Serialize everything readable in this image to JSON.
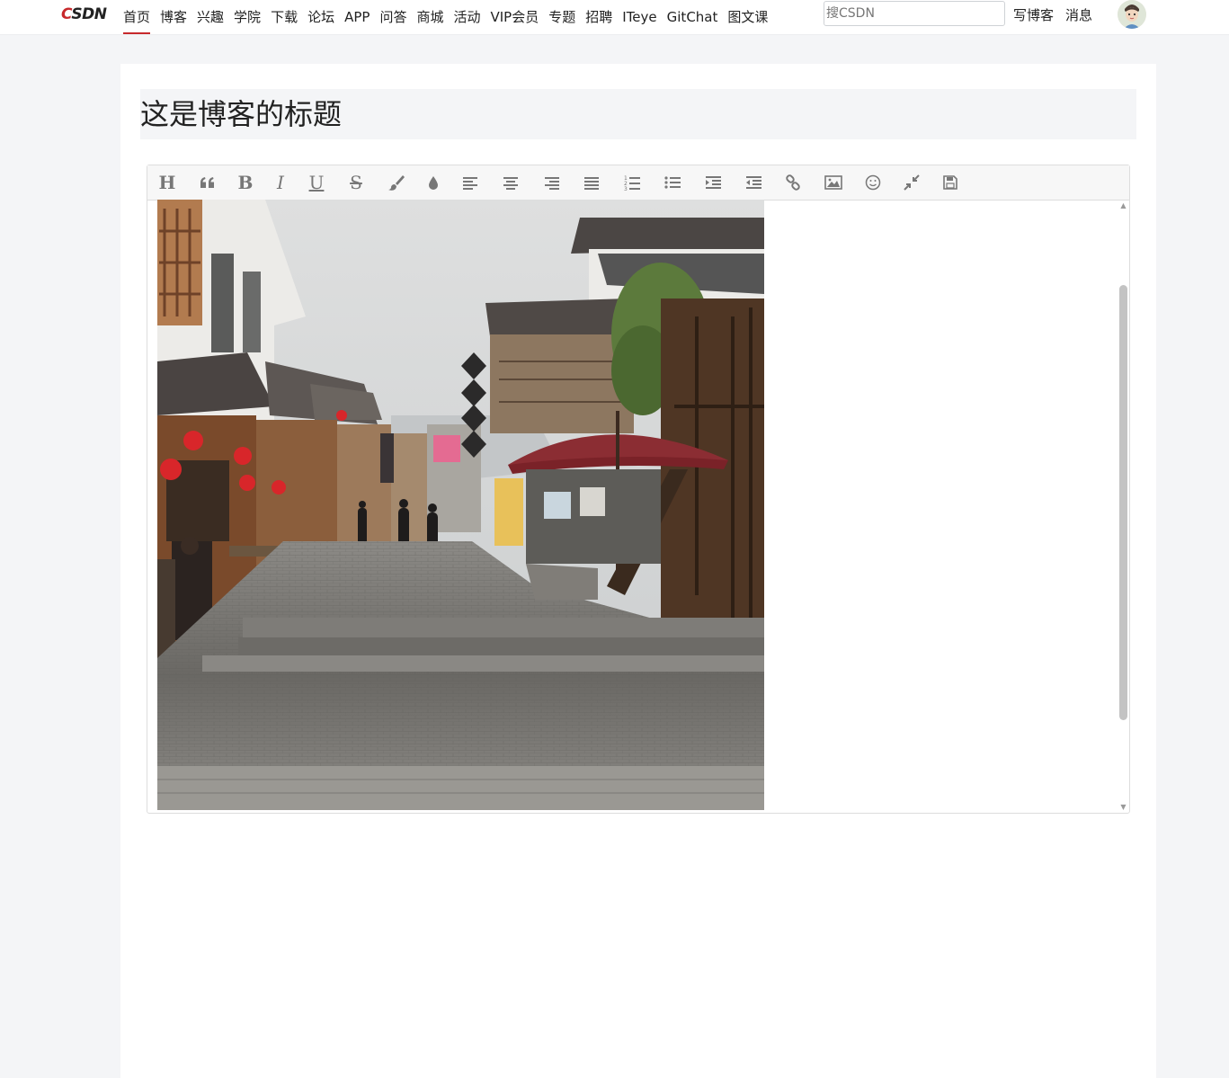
{
  "brand": {
    "logo_accent": "C",
    "logo_rest": "SDN",
    "accent_color": "#c7292c"
  },
  "nav": {
    "items": [
      "首页",
      "博客",
      "兴趣",
      "学院",
      "下载",
      "论坛",
      "APP",
      "问答",
      "商城",
      "活动",
      "VIP会员",
      "专题",
      "招聘",
      "ITeye",
      "GitChat",
      "图文课"
    ],
    "active_index": 0
  },
  "search": {
    "placeholder": "搜CSDN",
    "value": ""
  },
  "actions": {
    "write_blog": "写博客",
    "messages": "消息"
  },
  "post": {
    "title": "这是博客的标题"
  },
  "toolbar": {
    "buttons": [
      {
        "name": "heading",
        "icon": "heading-icon",
        "glyph": "H"
      },
      {
        "name": "quote",
        "icon": "quote-icon"
      },
      {
        "name": "bold",
        "icon": "bold-icon",
        "glyph": "B"
      },
      {
        "name": "italic",
        "icon": "italic-icon",
        "glyph": "I"
      },
      {
        "name": "underline",
        "icon": "underline-icon",
        "glyph": "U"
      },
      {
        "name": "strikethrough",
        "icon": "strikethrough-icon",
        "glyph": "S"
      },
      {
        "name": "brush",
        "icon": "brush-icon"
      },
      {
        "name": "color",
        "icon": "color-drop-icon"
      },
      {
        "name": "align-left",
        "icon": "align-left-icon"
      },
      {
        "name": "align-center",
        "icon": "align-center-icon"
      },
      {
        "name": "align-right",
        "icon": "align-right-icon"
      },
      {
        "name": "justify",
        "icon": "align-justify-icon"
      },
      {
        "name": "ordered-list",
        "icon": "ordered-list-icon"
      },
      {
        "name": "unordered-list",
        "icon": "unordered-list-icon"
      },
      {
        "name": "indent",
        "icon": "indent-icon"
      },
      {
        "name": "outdent",
        "icon": "outdent-icon"
      },
      {
        "name": "link",
        "icon": "link-icon"
      },
      {
        "name": "image",
        "icon": "image-icon"
      },
      {
        "name": "emoji",
        "icon": "emoji-icon"
      },
      {
        "name": "fullscreen-exit",
        "icon": "compress-icon"
      },
      {
        "name": "save",
        "icon": "save-icon"
      }
    ]
  },
  "editor_scroll": {
    "position_fraction": 0.14,
    "visible_fraction": 0.71
  }
}
